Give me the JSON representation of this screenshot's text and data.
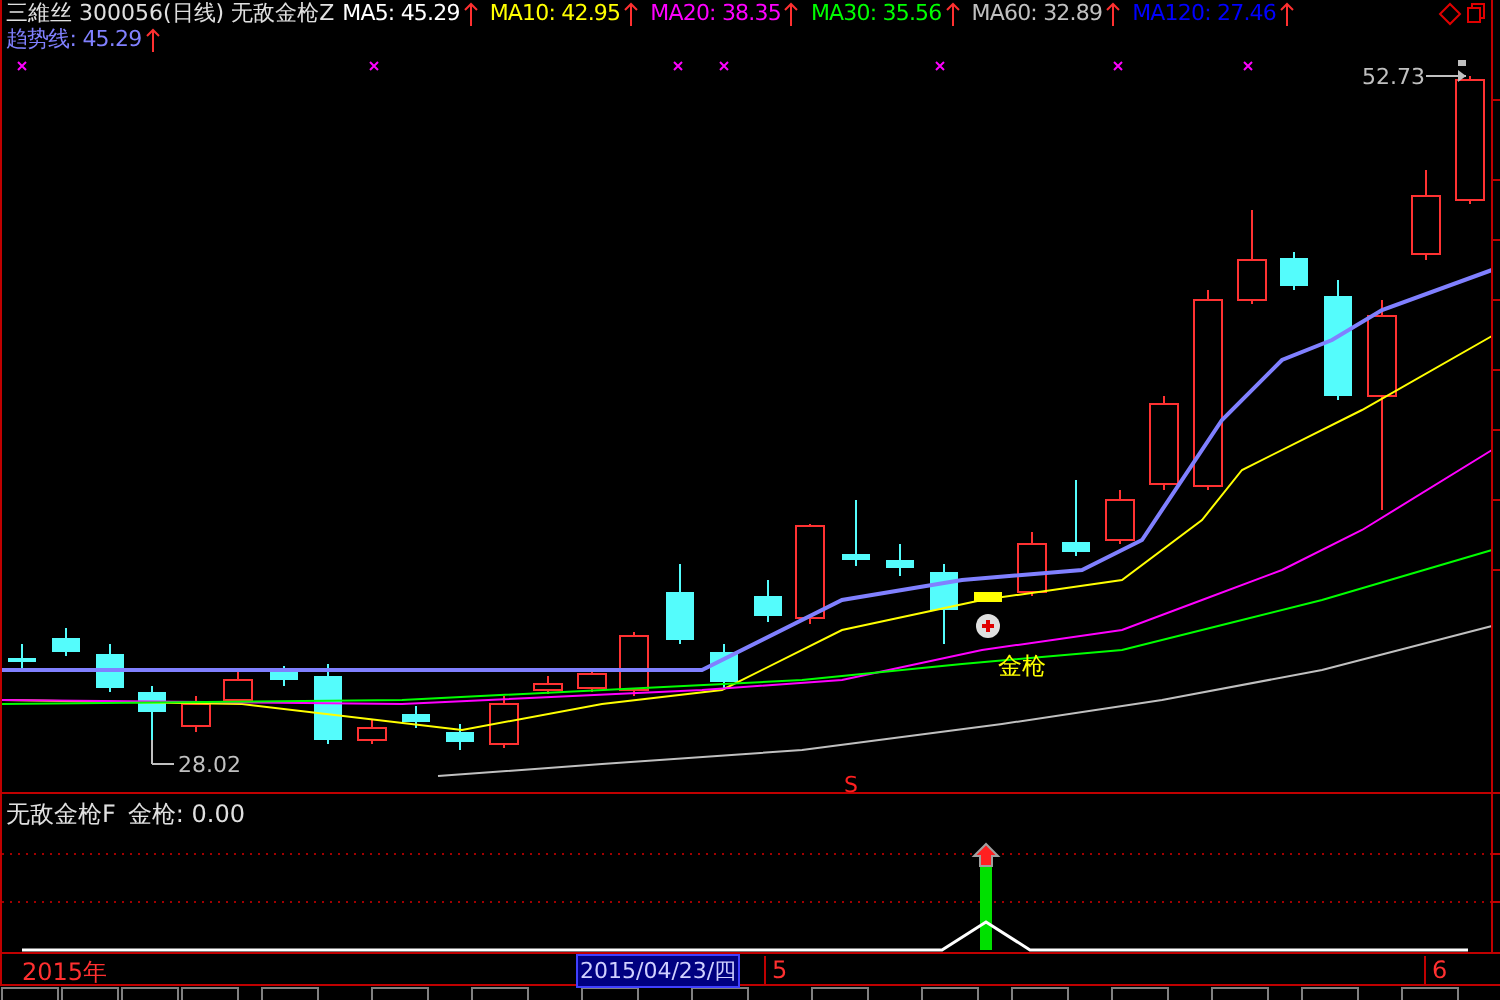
{
  "header": {
    "title": "三維丝 300056(日线) 无敌金枪Z",
    "indicators": [
      {
        "text": "MA5: 45.29",
        "color": "#ffffff",
        "up": true
      },
      {
        "text": "MA10: 42.95",
        "color": "#ffff00",
        "up": true
      },
      {
        "text": "MA20: 38.35",
        "color": "#ff00ff",
        "up": true
      },
      {
        "text": "MA30: 35.56",
        "color": "#00ff00",
        "up": true
      },
      {
        "text": "MA60: 32.89",
        "color": "#c0c0c0",
        "up": true
      },
      {
        "text": "MA120: 27.46",
        "color": "#0000ff",
        "up": true
      }
    ],
    "trend": {
      "text": "趋势线: 45.29",
      "color": "#8080ff",
      "up": true
    }
  },
  "chart": {
    "high_label": "52.73",
    "low_label": "28.02",
    "signal_label": "金枪",
    "cursor_mark": "S"
  },
  "indicator_panel": {
    "name": "无敌金枪F",
    "reading": "金枪: 0.00"
  },
  "date_bar": {
    "year": "2015年",
    "date": "2015/04/23/四",
    "months": [
      "5",
      "6"
    ]
  }
}
